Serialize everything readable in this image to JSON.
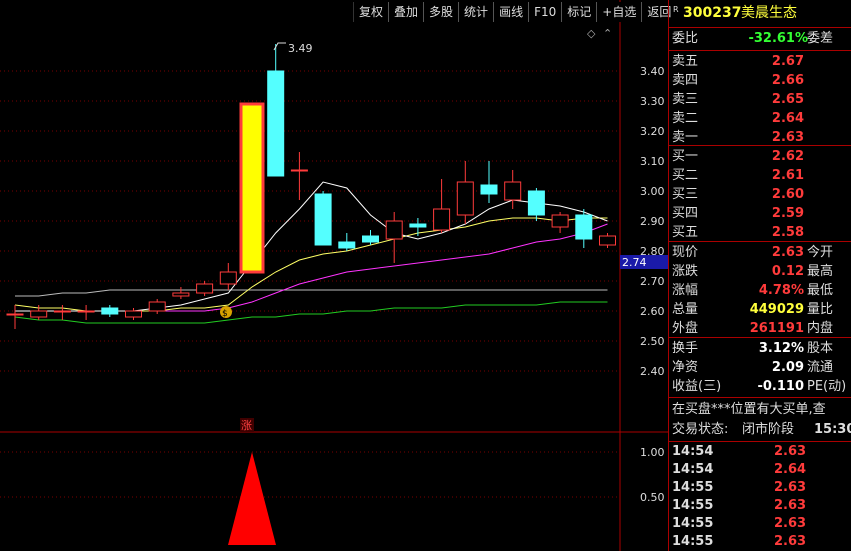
{
  "toolbar": [
    "复权",
    "叠加",
    "多股",
    "统计",
    "画线",
    "F10",
    "标记",
    "+自选",
    "返回"
  ],
  "chart_data": {
    "type": "candlestick",
    "peak_label": "3.49",
    "price_axis": [
      "3.40",
      "3.30",
      "3.20",
      "3.10",
      "3.00",
      "2.90",
      "2.80",
      "2.70",
      "2.60",
      "2.50",
      "2.40"
    ],
    "current_price_tag": "2.74",
    "indicator_axis": [
      "1.00",
      "0.50"
    ],
    "limit_up_marker": "涨",
    "candles": [
      {
        "o": 2.59,
        "c": 2.59,
        "h": 2.62,
        "l": 2.54
      },
      {
        "o": 2.58,
        "c": 2.6,
        "h": 2.62,
        "l": 2.57
      },
      {
        "o": 2.6,
        "c": 2.6,
        "h": 2.62,
        "l": 2.57
      },
      {
        "o": 2.6,
        "c": 2.6,
        "h": 2.62,
        "l": 2.57
      },
      {
        "o": 2.61,
        "c": 2.59,
        "h": 2.62,
        "l": 2.58
      },
      {
        "o": 2.58,
        "c": 2.6,
        "h": 2.61,
        "l": 2.57
      },
      {
        "o": 2.6,
        "c": 2.63,
        "h": 2.64,
        "l": 2.59
      },
      {
        "o": 2.65,
        "c": 2.66,
        "h": 2.68,
        "l": 2.64
      },
      {
        "o": 2.66,
        "c": 2.69,
        "h": 2.7,
        "l": 2.65
      },
      {
        "o": 2.69,
        "c": 2.73,
        "h": 2.76,
        "l": 2.67
      },
      {
        "o": 2.73,
        "c": 3.29,
        "h": 3.29,
        "l": 2.73
      },
      {
        "o": 3.4,
        "c": 3.05,
        "h": 3.49,
        "l": 3.05
      },
      {
        "o": 3.07,
        "c": 3.07,
        "h": 3.13,
        "l": 2.97
      },
      {
        "o": 2.99,
        "c": 2.82,
        "h": 3.0,
        "l": 2.82
      },
      {
        "o": 2.83,
        "c": 2.81,
        "h": 2.86,
        "l": 2.8
      },
      {
        "o": 2.85,
        "c": 2.83,
        "h": 2.87,
        "l": 2.82
      },
      {
        "o": 2.84,
        "c": 2.9,
        "h": 2.93,
        "l": 2.76
      },
      {
        "o": 2.89,
        "c": 2.88,
        "h": 2.91,
        "l": 2.85
      },
      {
        "o": 2.87,
        "c": 2.94,
        "h": 3.04,
        "l": 2.86
      },
      {
        "o": 2.92,
        "c": 3.03,
        "h": 3.1,
        "l": 2.89
      },
      {
        "o": 3.02,
        "c": 2.99,
        "h": 3.1,
        "l": 2.96
      },
      {
        "o": 2.97,
        "c": 3.03,
        "h": 3.07,
        "l": 2.94
      },
      {
        "o": 3.0,
        "c": 2.92,
        "h": 3.01,
        "l": 2.9
      },
      {
        "o": 2.88,
        "c": 2.92,
        "h": 2.93,
        "l": 2.86
      },
      {
        "o": 2.92,
        "c": 2.84,
        "h": 2.94,
        "l": 2.81
      },
      {
        "o": 2.82,
        "c": 2.85,
        "h": 2.86,
        "l": 2.81
      }
    ],
    "ma5": [
      2.6,
      2.6,
      2.6,
      2.6,
      2.6,
      2.6,
      2.61,
      2.62,
      2.64,
      2.66,
      2.76,
      2.86,
      2.94,
      3.03,
      3.01,
      2.92,
      2.86,
      2.84,
      2.86,
      2.89,
      2.94,
      2.97,
      2.96,
      2.95,
      2.93,
      2.9
    ],
    "ma10": [
      2.62,
      2.61,
      2.61,
      2.6,
      2.6,
      2.6,
      2.6,
      2.61,
      2.61,
      2.62,
      2.68,
      2.73,
      2.77,
      2.79,
      2.8,
      2.82,
      2.84,
      2.86,
      2.87,
      2.88,
      2.9,
      2.91,
      2.91,
      2.9,
      2.91,
      2.91
    ],
    "ma20": [
      2.6,
      2.6,
      2.6,
      2.6,
      2.6,
      2.6,
      2.6,
      2.6,
      2.6,
      2.61,
      2.63,
      2.66,
      2.69,
      2.71,
      2.73,
      2.74,
      2.75,
      2.76,
      2.77,
      2.78,
      2.79,
      2.81,
      2.83,
      2.84,
      2.86,
      2.89
    ],
    "ma_gray": [
      2.65,
      2.65,
      2.66,
      2.66,
      2.67,
      2.67,
      2.67,
      2.67,
      2.67,
      2.67,
      2.67,
      2.67,
      2.67,
      2.67,
      2.67,
      2.67,
      2.67,
      2.67,
      2.67,
      2.67,
      2.67,
      2.67,
      2.67,
      2.67,
      2.67,
      2.67
    ],
    "ma_green": [
      2.58,
      2.57,
      2.57,
      2.56,
      2.56,
      2.56,
      2.56,
      2.56,
      2.56,
      2.57,
      2.58,
      2.58,
      2.59,
      2.59,
      2.6,
      2.6,
      2.61,
      2.61,
      2.61,
      2.62,
      2.62,
      2.62,
      2.62,
      2.63,
      2.63,
      2.63
    ],
    "indicator_peak": {
      "index": 10,
      "value": 1.0
    }
  },
  "stock": {
    "code": "300237",
    "name": "美晨生态"
  },
  "weibi": {
    "label": "委比",
    "value": "-32.61%",
    "label2": "委差"
  },
  "sell": [
    {
      "label": "卖五",
      "price": "2.67"
    },
    {
      "label": "卖四",
      "price": "2.66"
    },
    {
      "label": "卖三",
      "price": "2.65"
    },
    {
      "label": "卖二",
      "price": "2.64"
    },
    {
      "label": "卖一",
      "price": "2.63"
    }
  ],
  "buy": [
    {
      "label": "买一",
      "price": "2.62"
    },
    {
      "label": "买二",
      "price": "2.61"
    },
    {
      "label": "买三",
      "price": "2.60"
    },
    {
      "label": "买四",
      "price": "2.59"
    },
    {
      "label": "买五",
      "price": "2.58"
    }
  ],
  "stats1": [
    {
      "a": "现价",
      "v": "2.63",
      "b": "今开"
    },
    {
      "a": "涨跌",
      "v": "0.12",
      "b": "最高"
    },
    {
      "a": "涨幅",
      "v": "4.78%",
      "b": "最低"
    },
    {
      "a": "总量",
      "v": "449029",
      "b": "量比"
    },
    {
      "a": "外盘",
      "v": "261191",
      "b": "内盘"
    }
  ],
  "stats2": [
    {
      "a": "换手",
      "v": "3.12%",
      "b": "股本"
    },
    {
      "a": "净资",
      "v": "2.09",
      "b": "流通"
    },
    {
      "a": "收益(三)",
      "v": "-0.110",
      "b": "PE(动)"
    }
  ],
  "notice": "在买盘***位置有大买单,查",
  "status": {
    "label": "交易状态:",
    "value": "闭市阶段",
    "time": "15:30:"
  },
  "ticks": [
    {
      "t": "14:54",
      "p": "2.63"
    },
    {
      "t": "14:54",
      "p": "2.64"
    },
    {
      "t": "14:55",
      "p": "2.63"
    },
    {
      "t": "14:55",
      "p": "2.63"
    },
    {
      "t": "14:55",
      "p": "2.63"
    },
    {
      "t": "14:55",
      "p": "2.63"
    }
  ]
}
